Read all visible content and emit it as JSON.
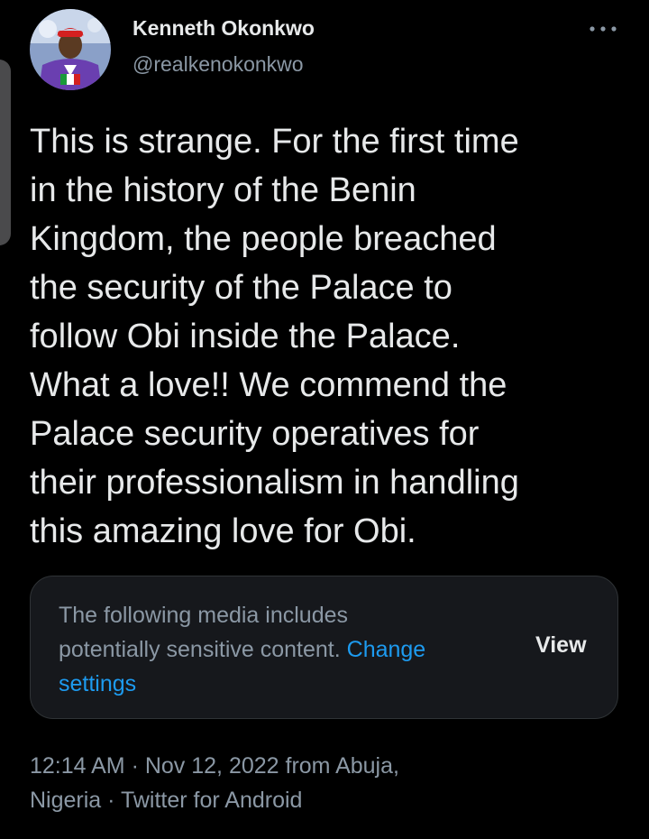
{
  "author": {
    "display_name": "Kenneth Okonkwo",
    "handle": "@realkenokonkwo",
    "avatar_icon": "profile-avatar-photo"
  },
  "more_icon": "more-horizontal-icon",
  "tweet": {
    "lines": [
      "This is strange. For the first time",
      "in the history of the Benin",
      "Kingdom, the people breached",
      "the security of the Palace to",
      "follow Obi inside the Palace.",
      "What a love!! We commend the",
      "Palace security operatives for",
      "their professionalism in handling",
      "this amazing love for Obi."
    ]
  },
  "media_warning": {
    "line1": "The following media includes",
    "line2": "potentially sensitive content.",
    "link_part1": "Change",
    "link_part2": "settings",
    "view_label": "View"
  },
  "meta": {
    "line1": "12:14 AM · Nov 12, 2022 from Abuja,",
    "line2": "Nigeria · Twitter for Android"
  },
  "colors": {
    "background": "#000000",
    "primary_text": "#e7e9ea",
    "secondary_text": "#8b98a5",
    "link": "#1d9bf0",
    "card_bg": "#16181c",
    "card_border": "#2f3336"
  }
}
